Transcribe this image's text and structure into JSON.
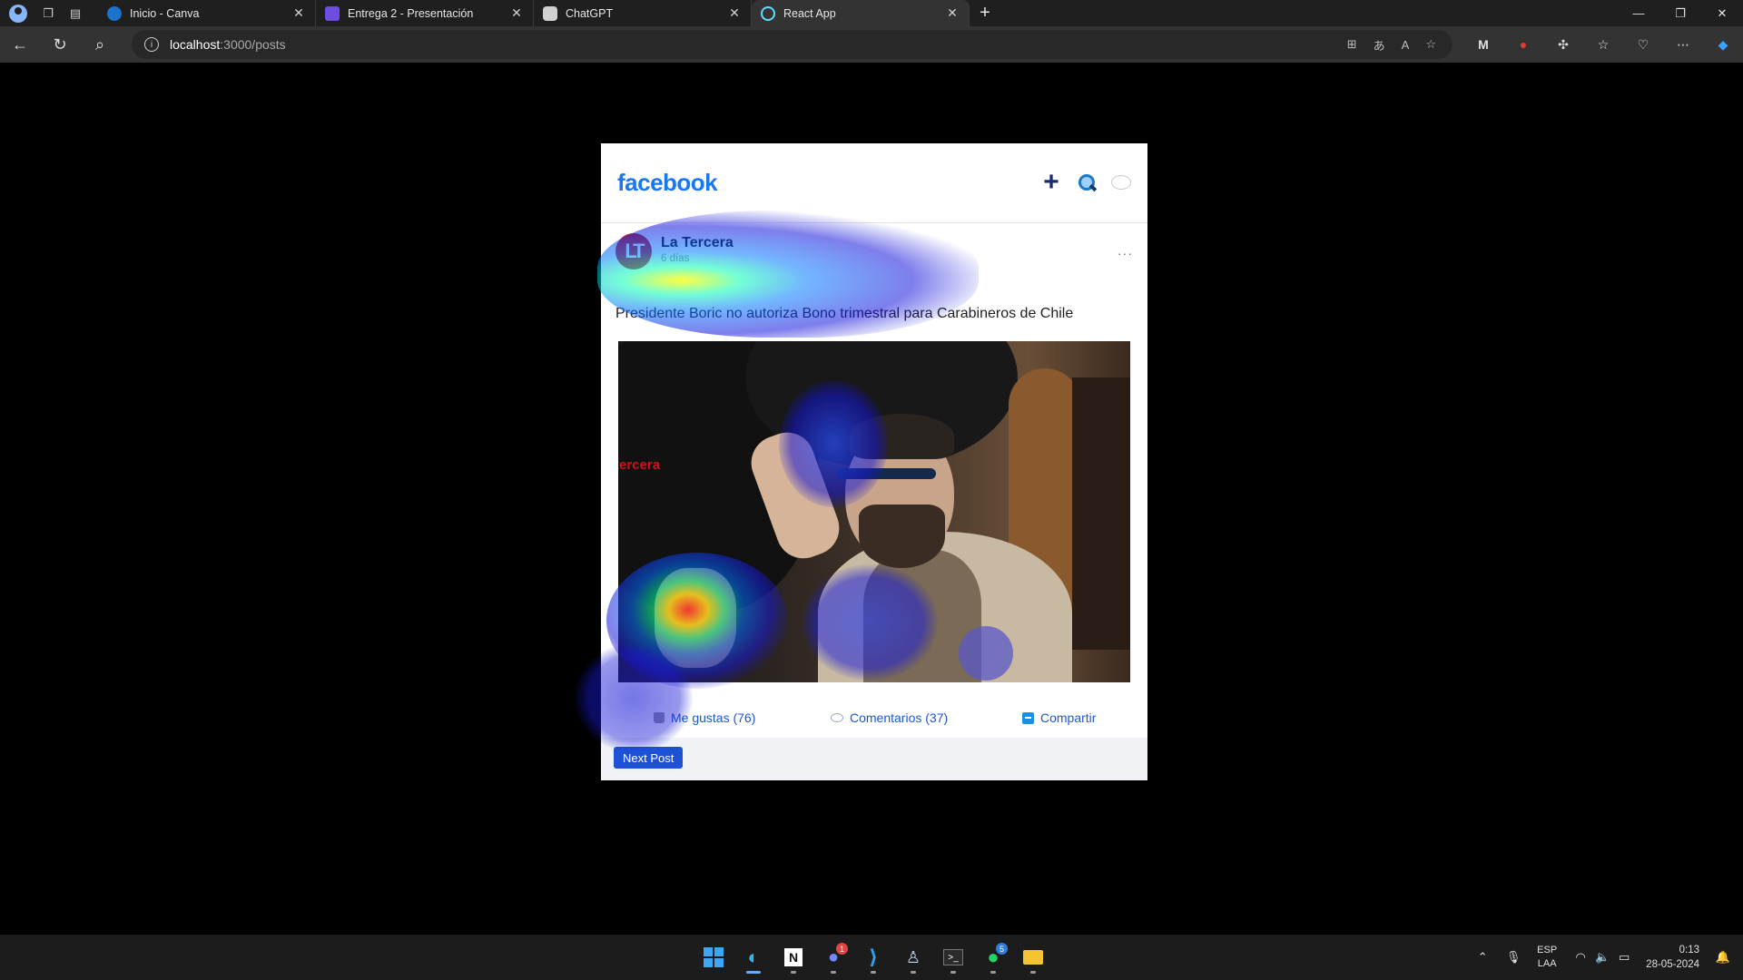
{
  "browser": {
    "tabs": [
      {
        "label": "Inicio - Canva",
        "favicon_color": "#1a73c8",
        "active": false
      },
      {
        "label": "Entrega 2 - Presentación",
        "favicon_color": "#6c4ee3",
        "active": false
      },
      {
        "label": "ChatGPT",
        "favicon_color": "#d0d0d0",
        "active": false
      },
      {
        "label": "React App",
        "favicon_color": "#61dafb",
        "active": true
      }
    ],
    "address": {
      "host": "localhost",
      "path": ":3000/posts"
    }
  },
  "feed": {
    "logo": "facebook",
    "post": {
      "avatar_initials": "LT",
      "author": "La Tercera",
      "time": "6 días",
      "text": "Presidente Boric no autoriza Bono trimestral para Carabineros de Chile",
      "image_watermark": "tercera",
      "actions": {
        "like_label": "Me gustas (76)",
        "comment_label": "Comentarios (37)",
        "share_label": "Compartir"
      }
    },
    "next_label": "Next Post"
  },
  "taskbar": {
    "lang_top": "ESP",
    "lang_bottom": "LAA",
    "time": "0:13",
    "date": "28-05-2024",
    "discord_badge": "1",
    "whatsapp_badge": "5"
  },
  "colors": {
    "brand": "#1877f2",
    "action_link": "#1a57d8",
    "next_button": "#1e52d6"
  }
}
